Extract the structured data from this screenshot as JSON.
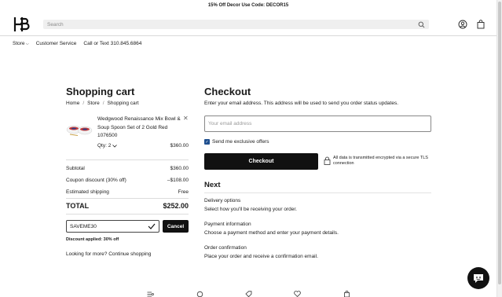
{
  "promo": "15% Off Decor Use Code: DECOR15",
  "search": {
    "placeholder": "Search"
  },
  "nav": {
    "store": "Store",
    "customer_service": "Customer Service",
    "call": "Call or Text 310.845.6864"
  },
  "cart": {
    "title": "Shopping cart",
    "breadcrumbs": [
      "Home",
      "Store",
      "Shopping cart"
    ],
    "item": {
      "name": "Wedgwood Renaissance Mix Bowl & Soup Spoon Set of 2 Gold Red 1076500",
      "qty": "Qty: 2",
      "price": "$360.00"
    },
    "summary": [
      {
        "label": "Subtotal",
        "value": "$360.00"
      },
      {
        "label": "Coupon discount (30% off)",
        "value": "–$108.00"
      },
      {
        "label": "Estimated shipping",
        "value": "Free"
      }
    ],
    "total": {
      "label": "TOTAL",
      "value": "$252.00"
    },
    "coupon": {
      "code": "SAVEME30",
      "cancel": "Cancel",
      "applied": "Discount applied: 30% off"
    },
    "more": "Looking for more? Continue shopping"
  },
  "checkout": {
    "title": "Checkout",
    "lede": "Enter your email address. This address will be used to send you order status updates.",
    "email_placeholder": "Your email address",
    "optin": "Send me exclusive offers",
    "optin_checked": true,
    "button": "Checkout",
    "secure": "All data is transmitted encrypted via a secure TLS connection"
  },
  "next": {
    "title": "Next",
    "steps": [
      {
        "title": "Delivery options",
        "desc": "Select how you'll be receiving your order."
      },
      {
        "title": "Payment information",
        "desc": "Choose a payment method and enter your payment details."
      },
      {
        "title": "Order confirmation",
        "desc": "Place your order and receive a confirmation email."
      }
    ]
  },
  "icons": {
    "account": "user-icon",
    "bag": "bag-icon",
    "chat": "chat-icon",
    "footer": [
      "menu-icon",
      "search-icon",
      "tag-icon",
      "heart-icon",
      "bag-icon"
    ]
  },
  "colors": {
    "accent": "#111111",
    "checkbox": "#1f4f8f"
  }
}
